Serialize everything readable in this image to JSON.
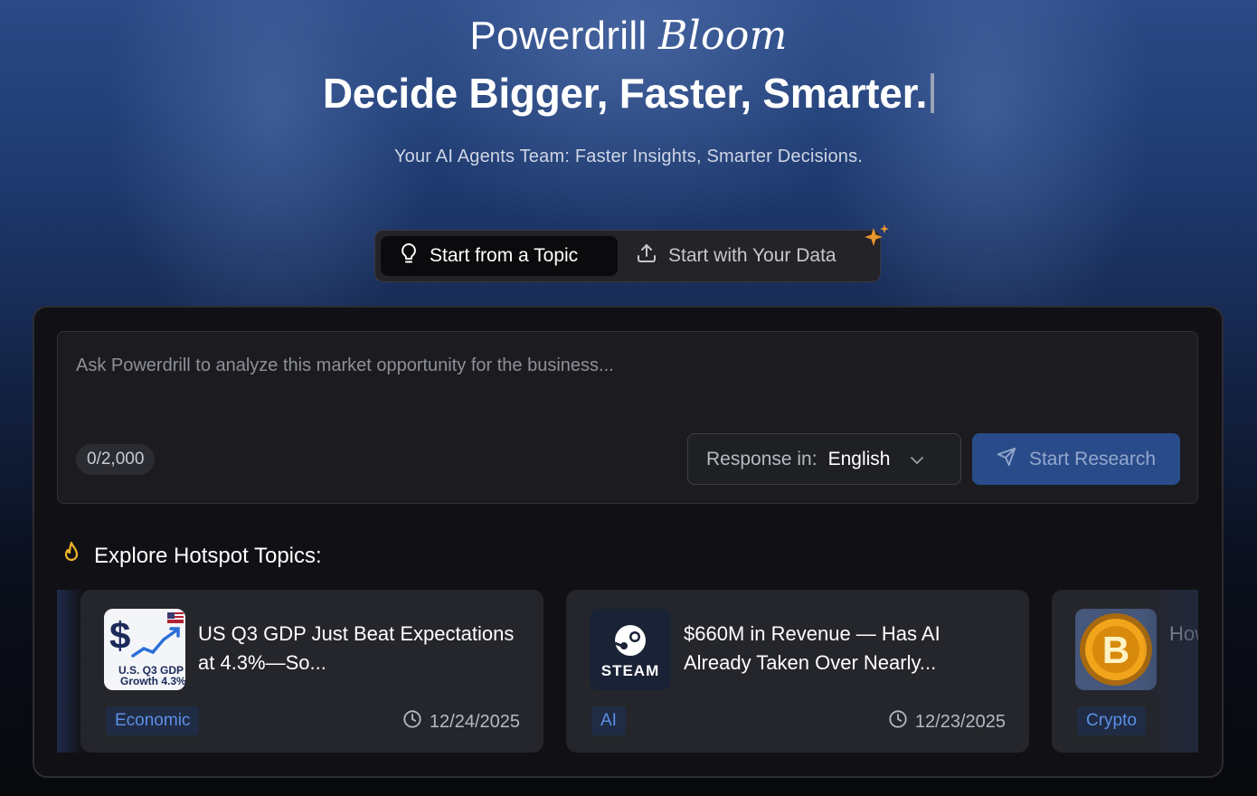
{
  "hero": {
    "brand": "Powerdrill",
    "brand_suffix": "Bloom",
    "tagline": "Decide Bigger, Faster, Smarter.",
    "subtitle": "Your AI Agents Team: Faster Insights, Smarter Decisions."
  },
  "mode_switch": {
    "topic_label": "Start from a Topic",
    "data_label": "Start with Your Data",
    "active": "topic"
  },
  "prompt": {
    "placeholder": "Ask Powerdrill to analyze this market opportunity for the business...",
    "value": "",
    "char_count": "0/2,000",
    "response_label": "Response in:",
    "response_language": "English",
    "start_button": "Start Research"
  },
  "hotspot": {
    "title": "Explore Hotspot Topics:",
    "cards": [
      {
        "title": "US Q3 GDP Just Beat Expectations at 4.3%—So...",
        "tag": "Economic",
        "date": "12/24/2025",
        "thumb_caption_1": "U.S. Q3 GDP",
        "thumb_caption_2": "Growth 4.3%"
      },
      {
        "title": "$660M in Revenue — Has AI Already Taken Over Nearly...",
        "tag": "AI",
        "date": "12/23/2025",
        "thumb_caption_1": "STEAM"
      },
      {
        "title": "How ye...",
        "tag": "Crypto",
        "date": ""
      }
    ]
  },
  "colors": {
    "accent_blue": "#2a4b8a",
    "tag_text": "#5d8fe6",
    "sparkle": "#e8952e",
    "flame": "#f0b429"
  }
}
